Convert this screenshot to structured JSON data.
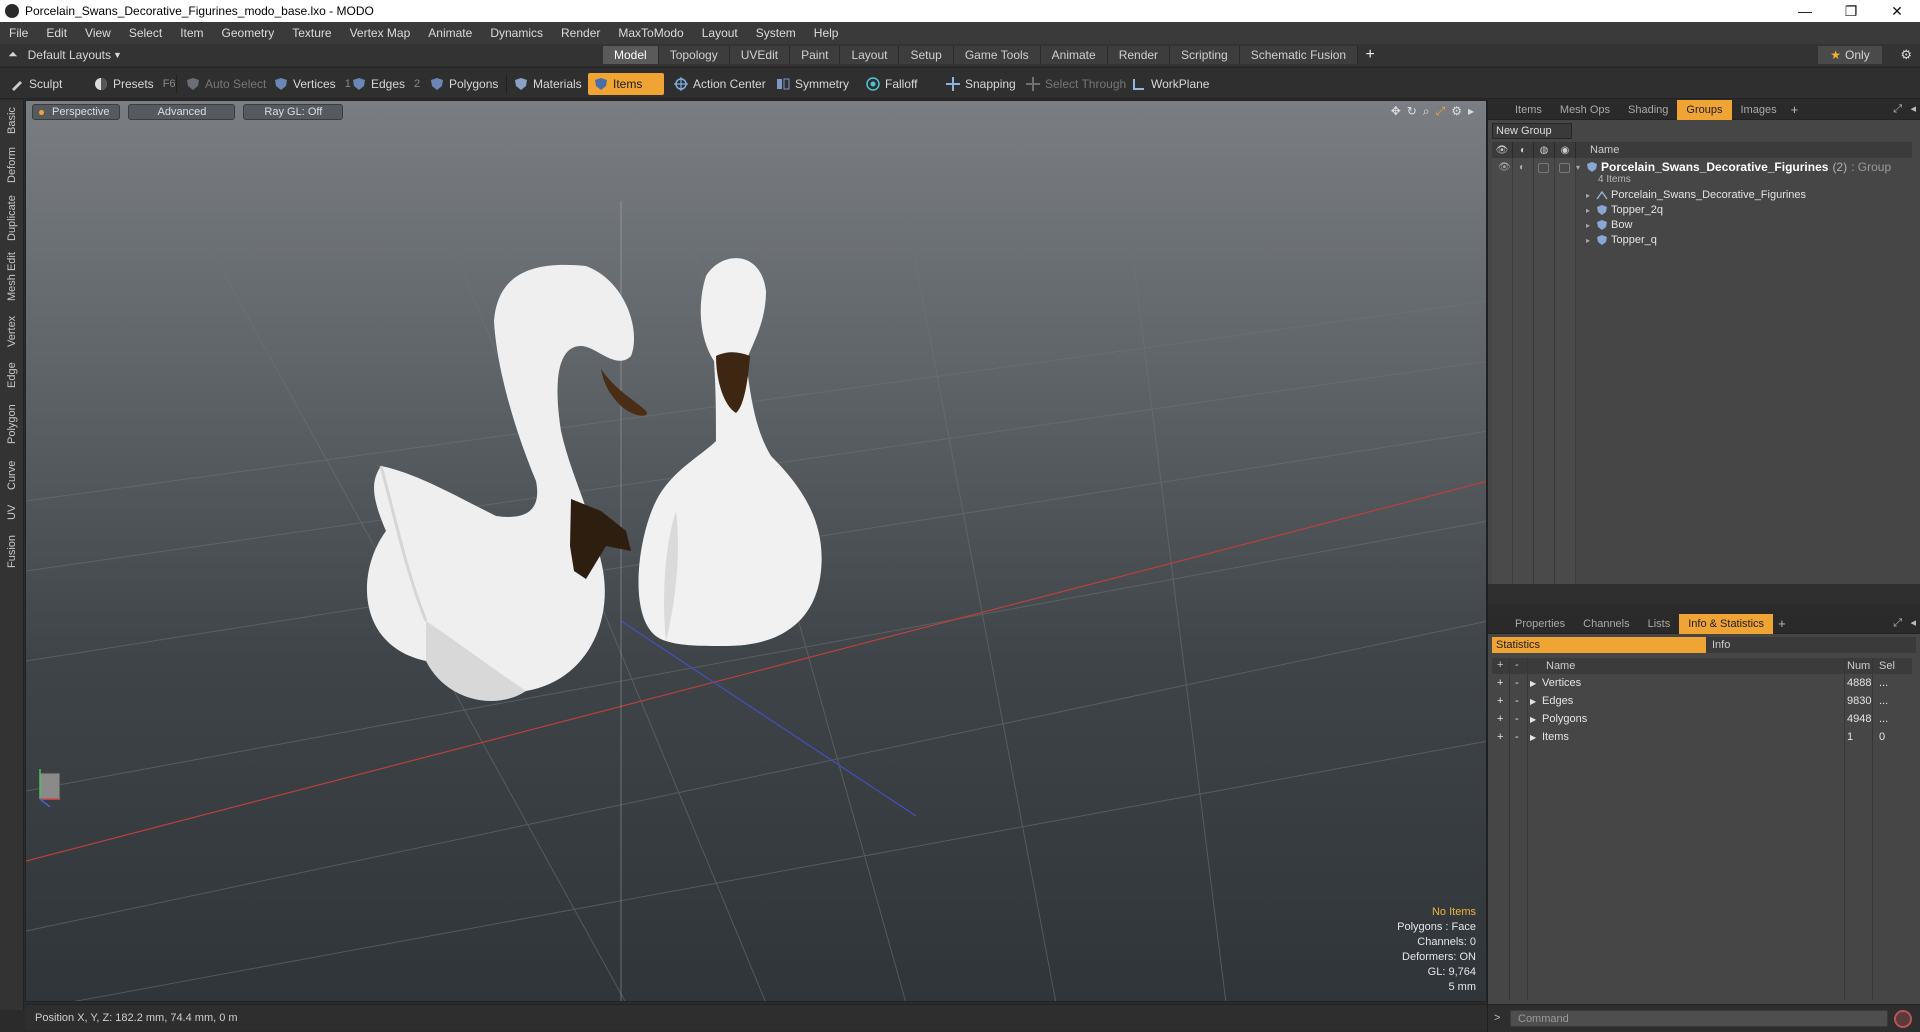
{
  "window": {
    "title": "Porcelain_Swans_Decorative_Figurines_modo_base.lxo - MODO",
    "controls": [
      "—",
      "❐",
      "✕"
    ]
  },
  "menu": [
    "File",
    "Edit",
    "View",
    "Select",
    "Item",
    "Geometry",
    "Texture",
    "Vertex Map",
    "Animate",
    "Dynamics",
    "Render",
    "MaxToModo",
    "Layout",
    "System",
    "Help"
  ],
  "layout_bar": {
    "layout_selector": "Default Layouts",
    "tabs": [
      "Model",
      "Topology",
      "UVEdit",
      "Paint",
      "Layout",
      "Setup",
      "Game Tools",
      "Animate",
      "Render",
      "Scripting",
      "Schematic Fusion"
    ],
    "active_tab": "Model",
    "only_label": "Only"
  },
  "toolbar": {
    "sculpt": "Sculpt",
    "presets": "Presets",
    "presets_key": "F6",
    "auto_select": "Auto Select",
    "vertices": "Vertices",
    "vertices_key": "1",
    "edges": "Edges",
    "edges_key": "2",
    "polygons": "Polygons",
    "materials": "Materials",
    "items": "Items",
    "action_center": "Action Center",
    "symmetry": "Symmetry",
    "falloff": "Falloff",
    "snapping": "Snapping",
    "select_through": "Select Through",
    "workplane": "WorkPlane"
  },
  "left_tabs": [
    "Basic",
    "Deform",
    "Duplicate",
    "Mesh Edit",
    "Vertex",
    "Edge",
    "Polygon",
    "Curve",
    "UV",
    "Fusion"
  ],
  "viewport": {
    "view_mode": "Perspective",
    "shading": "Advanced",
    "raygl": "Ray GL: Off",
    "info": {
      "selection": "No Items",
      "polygons": "Polygons : Face",
      "channels": "Channels: 0",
      "deformers": "Deformers: ON",
      "gl": "GL: 9,764",
      "grid": "5 mm"
    }
  },
  "status_bar": {
    "position": "Position X, Y, Z:   182.2 mm, 74.4 mm, 0 m"
  },
  "groups_panel": {
    "tabs": [
      "Items",
      "Mesh Ops",
      "Shading",
      "Groups",
      "Images"
    ],
    "active_tab": "Groups",
    "new_group": "New Group",
    "column_name": "Name",
    "group": {
      "name": "Porcelain_Swans_Decorative_Figurines",
      "count": "(2)",
      "type": ": Group",
      "sub": "4 Items"
    },
    "children": [
      "Porcelain_Swans_Decorative_Figurines",
      "Topper_2q",
      "Bow",
      "Topper_q"
    ]
  },
  "stats_panel": {
    "tabs": [
      "Properties",
      "Channels",
      "Lists",
      "Info & Statistics"
    ],
    "active_tab": "Info & Statistics",
    "subtabs": [
      "Statistics",
      "Info"
    ],
    "columns": {
      "name": "Name",
      "num": "Num",
      "sel": "Sel"
    },
    "rows": [
      {
        "name": "Vertices",
        "num": "4888",
        "sel": "..."
      },
      {
        "name": "Edges",
        "num": "9830",
        "sel": "..."
      },
      {
        "name": "Polygons",
        "num": "4948",
        "sel": "..."
      },
      {
        "name": "Items",
        "num": "1",
        "sel": "0"
      }
    ]
  },
  "command_bar": {
    "prompt": ">",
    "placeholder": "Command"
  },
  "colors": {
    "accent": "#f0a434",
    "viewport_top": "#7a7e82",
    "viewport_bottom": "#30353a",
    "axis_x": "#c0392b",
    "axis_z": "#3a4fc0"
  }
}
